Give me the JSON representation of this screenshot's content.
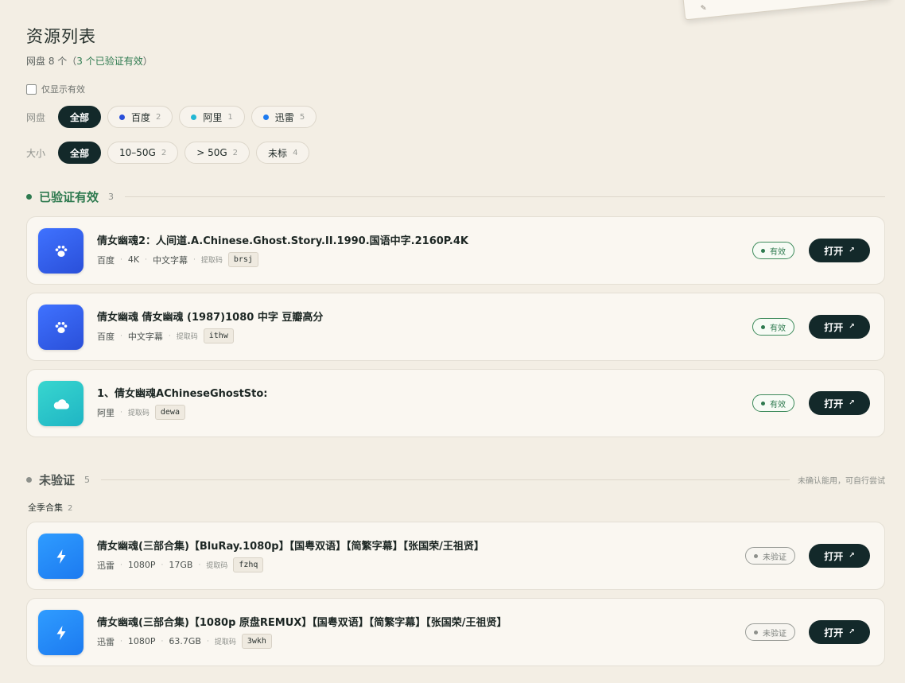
{
  "header": {
    "title": "资源列表",
    "subtitle_prefix": "网盘 8 个（",
    "subtitle_highlight": "3 个已验证有效",
    "subtitle_suffix": "）"
  },
  "only_valid_label": "仅显示有效",
  "filters": {
    "disk": {
      "label": "网盘",
      "chips": [
        {
          "label": "全部",
          "count": "",
          "active": true
        },
        {
          "label": "百度",
          "count": "2",
          "dot": "#2a4fd9"
        },
        {
          "label": "阿里",
          "count": "1",
          "dot": "#22b7d4"
        },
        {
          "label": "迅雷",
          "count": "5",
          "dot": "#1c7af0"
        }
      ]
    },
    "size": {
      "label": "大小",
      "chips": [
        {
          "label": "全部",
          "count": "",
          "active": true
        },
        {
          "label": "10–50G",
          "count": "2"
        },
        {
          "label": "> 50G",
          "count": "2"
        },
        {
          "label": "未标",
          "count": "4"
        }
      ]
    }
  },
  "sections": {
    "verified": {
      "title": "已验证有效",
      "count": "3",
      "color": "#2e7a4f"
    },
    "unverified": {
      "title": "未验证",
      "count": "5",
      "note": "未确认能用，可自行尝试",
      "color": "#6f736f"
    }
  },
  "group": {
    "label": "全季合集",
    "count": "2"
  },
  "code_label": "提取码",
  "open_label": "打开",
  "open_arrow": "↗",
  "status": {
    "valid": "有效",
    "unverified": "未验证"
  },
  "verified_items": [
    {
      "name": "倩女幽魂2：人间道.A.Chinese.Ghost.Story.II.1990.国语中字.2160P.4K",
      "meta": [
        "百度",
        "4K",
        "中文字幕"
      ],
      "code": "brsj",
      "icon": "baidu"
    },
    {
      "name": "倩女幽魂 倩女幽魂 (1987)1080 中字 豆瓣高分",
      "meta": [
        "百度",
        "中文字幕"
      ],
      "code": "ithw",
      "icon": "baidu"
    },
    {
      "name": "1、倩女幽魂AChineseGhostSto:",
      "meta": [
        "阿里"
      ],
      "code": "dewa",
      "icon": "ali"
    }
  ],
  "unverified_items": [
    {
      "name": "倩女幽魂(三部合集)【BluRay.1080p】【国粤双语】【简繁字幕】【张国荣/王祖贤】",
      "meta": [
        "迅雷",
        "1080P",
        "17GB"
      ],
      "code": "fzhq",
      "icon": "xunlei"
    },
    {
      "name": "倩女幽魂(三部合集)【1080p 原盘REMUX】【国粤双语】【简繁字幕】【张国荣/王祖贤】",
      "meta": [
        "迅雷",
        "1080P",
        "63.7GB"
      ],
      "code": "3wkh",
      "icon": "xunlei"
    }
  ]
}
